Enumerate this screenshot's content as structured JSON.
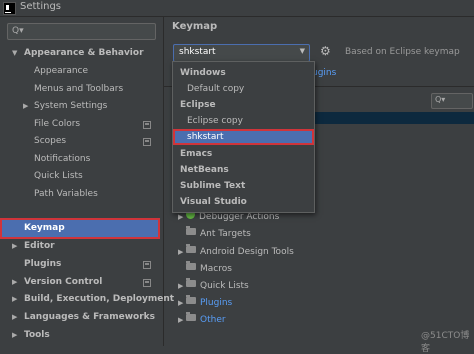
{
  "window": {
    "title": "Settings"
  },
  "sidebar": {
    "search_placeholder": "Q▾",
    "items": [
      {
        "label": "Appearance & Behavior",
        "bold": true,
        "expanded": true
      },
      {
        "label": "Appearance"
      },
      {
        "label": "Menus and Toolbars"
      },
      {
        "label": "System Settings",
        "collapsed": true
      },
      {
        "label": "File Colors"
      },
      {
        "label": "Scopes"
      },
      {
        "label": "Notifications"
      },
      {
        "label": "Quick Lists"
      },
      {
        "label": "Path Variables"
      },
      {
        "label": "Keymap",
        "bold": true,
        "selected": true
      },
      {
        "label": "Editor",
        "bold": true
      },
      {
        "label": "Plugins",
        "bold": true
      },
      {
        "label": "Version Control",
        "bold": true
      },
      {
        "label": "Build, Execution, Deployment",
        "bold": true
      },
      {
        "label": "Languages & Frameworks",
        "bold": true
      },
      {
        "label": "Tools",
        "bold": true
      }
    ]
  },
  "main": {
    "heading": "Keymap",
    "keymap_select_value": "shkstart",
    "based_on": "Based on Eclipse keymap",
    "plugins_link": "ugins",
    "right_search": "Q▾",
    "tree": [
      {
        "label": "Debugger Actions",
        "icon": "bug"
      },
      {
        "label": "Ant Targets",
        "icon": "folder"
      },
      {
        "label": "Android Design Tools",
        "icon": "folder"
      },
      {
        "label": "Macros",
        "icon": "folder"
      },
      {
        "label": "Quick Lists",
        "icon": "folder"
      },
      {
        "label": "Plugins",
        "icon": "folder",
        "link": true
      },
      {
        "label": "Other",
        "icon": "folder",
        "link": true
      }
    ]
  },
  "dropdown": {
    "options": [
      {
        "label": "Windows",
        "type": "group"
      },
      {
        "label": "Default copy",
        "type": "sub"
      },
      {
        "label": "Eclipse",
        "type": "group"
      },
      {
        "label": "Eclipse copy",
        "type": "sub"
      },
      {
        "label": "shkstart",
        "type": "sub",
        "selected": true
      },
      {
        "label": "Emacs",
        "type": "group"
      },
      {
        "label": "NetBeans",
        "type": "group"
      },
      {
        "label": "Sublime Text",
        "type": "group"
      },
      {
        "label": "Visual Studio",
        "type": "group"
      }
    ]
  },
  "watermark": "@51CTO博客",
  "colors": {
    "accent": "#4b6eaf",
    "highlight_border": "#d0343a",
    "link": "#589df6"
  }
}
